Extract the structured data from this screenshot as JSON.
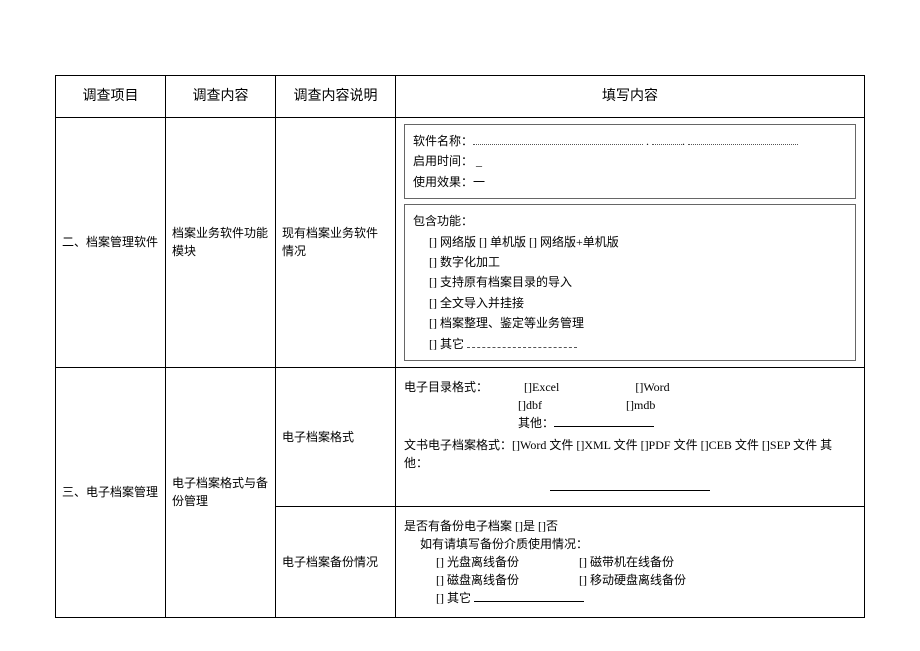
{
  "headers": {
    "col1": "调查项目",
    "col2": "调查内容",
    "col3": "调查内容说明",
    "col4": "填写内容"
  },
  "row1": {
    "project": "二、档案管理软件",
    "content": "档案业务软件功能模块",
    "desc": "现有档案业务软件情况",
    "box1": {
      "l1": "软件名称：",
      "l2": "启用时间：",
      "l3": "使用效果：一"
    },
    "box2": {
      "t": "包含功能：",
      "o1": "[] 网络版 [] 单机版 [] 网络版+单机版",
      "o2": "[] 数字化加工",
      "o3": "[] 支持原有档案目录的导入",
      "o4": "[] 全文导入并挂接",
      "o5": "[] 档案整理、鉴定等业务管理",
      "o6": "[] 其它"
    }
  },
  "row2": {
    "project": "三、电子档案管理",
    "content": "电子档案格式与备份管理",
    "sub1": {
      "desc": "电子档案格式",
      "fill": {
        "l1": "电子目录格式：",
        "o1a": "[]Excel",
        "o1b": "[]Word",
        "o2a": "[]dbf",
        "o2b": "[]mdb",
        "o3": "其他：",
        "l2": "文书电子档案格式：[]Word 文件 []XML 文件 []PDF 文件 []CEB 文件 []SEP 文件 其他："
      }
    },
    "sub2": {
      "desc": "电子档案备份情况",
      "fill": {
        "l1": "是否有备份电子档案 []是 []否",
        "l2": "如有请填写备份介质使用情况：",
        "o1a": "[] 光盘离线备份",
        "o1b": "[] 磁带机在线备份",
        "o2a": "[] 磁盘离线备份",
        "o2b": "[] 移动硬盘离线备份",
        "o3": "[] 其它"
      }
    }
  }
}
